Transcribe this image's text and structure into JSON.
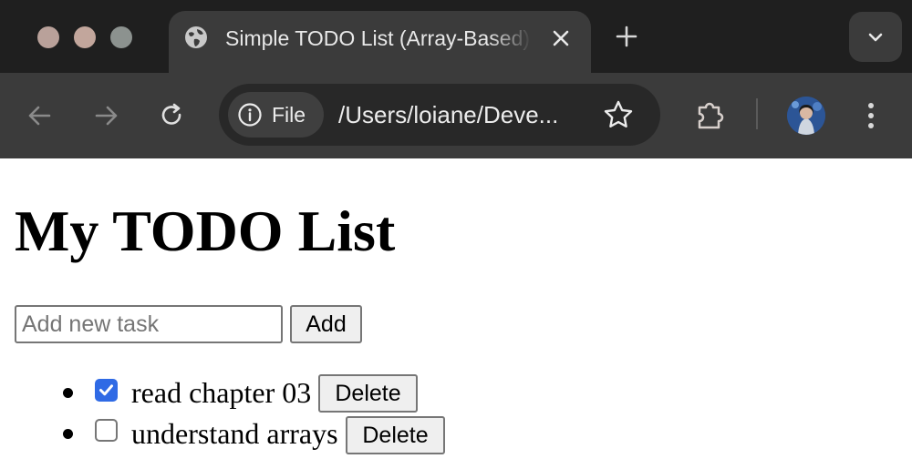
{
  "browser": {
    "tab": {
      "title": "Simple TODO List (Array-Based)"
    },
    "address_bar": {
      "chip_label": "File",
      "url": "/Users/loiane/Deve..."
    }
  },
  "page": {
    "heading": "My TODO List",
    "new_task_input": {
      "value": "",
      "placeholder": "Add new task"
    },
    "add_button_label": "Add",
    "tasks": [
      {
        "text": "read chapter 03",
        "done": true,
        "delete_label": "Delete"
      },
      {
        "text": "understand arrays",
        "done": false,
        "delete_label": "Delete"
      }
    ]
  },
  "colors": {
    "chrome_dark": "#1f1f1f",
    "chrome_toolbar": "#3b3b3b",
    "checkbox_accent": "#2f6ae5"
  }
}
